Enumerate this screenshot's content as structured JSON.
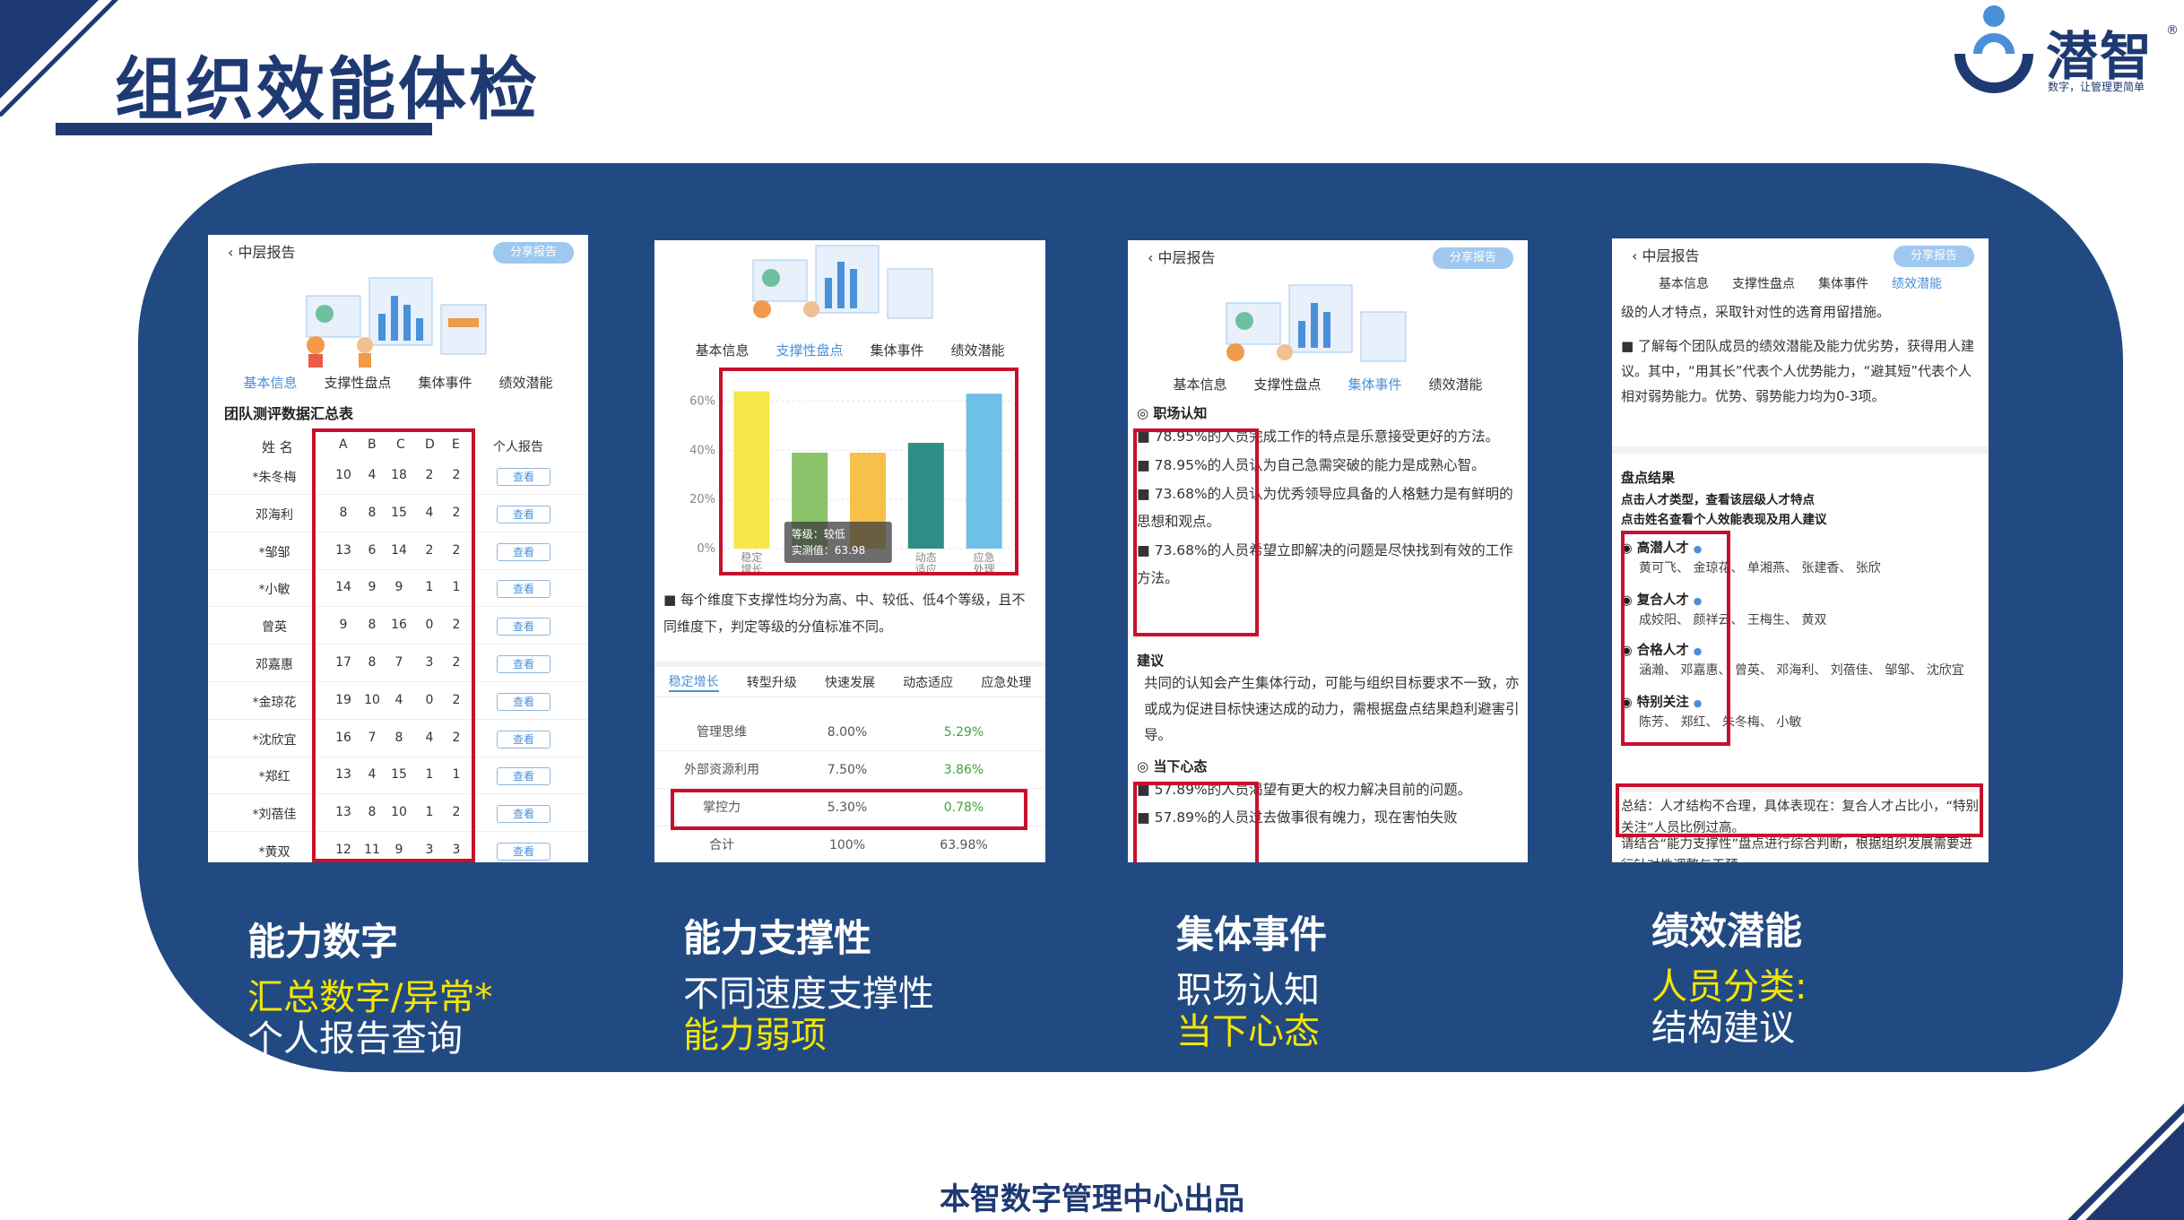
{
  "page": {
    "title": "组织效能体检",
    "footer": "本智数字管理中心出品"
  },
  "logo": {
    "text": "潜智",
    "slogan": "数字，让管理更简单",
    "reg": "®"
  },
  "colors": {
    "primary": "#1f3a72",
    "panel": "#224a82",
    "highlight": "#c8102e",
    "yellow": "#f4e500",
    "active_tab": "#4a90d9"
  },
  "card1": {
    "header_title": "中层报告",
    "share": "分享报告",
    "tabs": [
      "基本信息",
      "支撑性盘点",
      "集体事件",
      "绩效潜能"
    ],
    "section": "团队测评数据汇总表",
    "col_name": "姓  名",
    "cols": [
      "A",
      "B",
      "C",
      "D",
      "E"
    ],
    "col_report": "个人报告",
    "view": "查看",
    "rows": [
      {
        "name": "*朱冬梅",
        "vals": [
          "10",
          "4",
          "18",
          "2",
          "2"
        ]
      },
      {
        "name": "邓海利",
        "vals": [
          "8",
          "8",
          "15",
          "4",
          "2"
        ]
      },
      {
        "name": "*邹邹",
        "vals": [
          "13",
          "6",
          "14",
          "2",
          "2"
        ]
      },
      {
        "name": "*小敏",
        "vals": [
          "14",
          "9",
          "9",
          "1",
          "1"
        ]
      },
      {
        "name": "曾英",
        "vals": [
          "9",
          "8",
          "16",
          "0",
          "2"
        ]
      },
      {
        "name": "邓嘉惠",
        "vals": [
          "17",
          "8",
          "7",
          "3",
          "2"
        ]
      },
      {
        "name": "*金琼花",
        "vals": [
          "19",
          "10",
          "4",
          "0",
          "2"
        ]
      },
      {
        "name": "*沈欣宜",
        "vals": [
          "16",
          "7",
          "8",
          "4",
          "2"
        ]
      },
      {
        "name": "*郑红",
        "vals": [
          "13",
          "4",
          "15",
          "1",
          "1"
        ]
      },
      {
        "name": "*刘蓓佳",
        "vals": [
          "13",
          "8",
          "10",
          "1",
          "2"
        ]
      },
      {
        "name": "*黄双",
        "vals": [
          "12",
          "11",
          "9",
          "3",
          "3"
        ]
      }
    ]
  },
  "card2": {
    "tabs": [
      "基本信息",
      "支撑性盘点",
      "集体事件",
      "绩效潜能"
    ],
    "y_ticks": [
      "60%",
      "40%",
      "20%",
      "0%"
    ],
    "x_labels": [
      [
        "稳定",
        "增长"
      ],
      [
        "",
        ""
      ],
      [
        "",
        ""
      ],
      [
        "动态",
        "适应"
      ],
      [
        "应急",
        "处理"
      ]
    ],
    "tooltip_line1": "等级：较低",
    "tooltip_line2": "实测值：63.98",
    "desc": "每个维度下支撑性均分为高、中、较低、低4个等级，且不同维度下，判定等级的分值标准不同。",
    "sub_tabs": [
      "稳定增长",
      "转型升级",
      "快速发展",
      "动态适应",
      "应急处理"
    ],
    "table": [
      {
        "name": "管理思维",
        "a": "8.00%",
        "b": "5.29%"
      },
      {
        "name": "外部资源利用",
        "a": "7.50%",
        "b": "3.86%"
      },
      {
        "name": "掌控力",
        "a": "5.30%",
        "b": "0.78%"
      },
      {
        "name": "合计",
        "a": "100%",
        "b": "63.98%"
      }
    ]
  },
  "chart_data": {
    "type": "bar",
    "categories": [
      "稳定增长",
      "",
      "",
      "动态适应",
      "应急处理"
    ],
    "values": [
      63.98,
      39,
      39,
      43,
      63
    ],
    "colors": [
      "#f7e64a",
      "#8ac36a",
      "#f7c04a",
      "#2e8e86",
      "#6ec0e6"
    ],
    "ylim": [
      0,
      70
    ],
    "y_ticks": [
      0,
      20,
      40,
      60
    ],
    "grid": true
  },
  "card3": {
    "header_title": "中层报告",
    "share": "分享报告",
    "tabs": [
      "基本信息",
      "支撑性盘点",
      "集体事件",
      "绩效潜能"
    ],
    "sec1": "职场认知",
    "bullets1": [
      "78.95%的人员完成工作的特点是乐意接受更好的方法。",
      "78.95%的人员认为自己急需突破的能力是成熟心智。",
      "73.68%的人员认为优秀领导应具备的人格魅力是有鲜明的思想和观点。",
      "73.68%的人员希望立即解决的问题是尽快找到有效的工作方法。"
    ],
    "suggest_title": "建议",
    "suggest": "共同的认知会产生集体行动，可能与组织目标要求不一致，亦或成为促进目标快速达成的动力，需根据盘点结果趋利避害引导。",
    "sec2": "当下心态",
    "bullets2": [
      "57.89%的人员渴望有更大的权力解决目前的问题。",
      "57.89%的人员过去做事很有魄力，现在害怕失败"
    ]
  },
  "card4": {
    "header_title": "中层报告",
    "share": "分享报告",
    "tabs": [
      "基本信息",
      "支撑性盘点",
      "集体事件",
      "绩效潜能"
    ],
    "intro1": "级的人才特点，采取针对性的选育用留措施。",
    "intro2": "了解每个团队成员的绩效潜能及能力优劣势，获得用人建议。其中，“用其长”代表个人优势能力，“避其短”代表个人相对弱势能力。优势、弱势能力均为0-3项。",
    "result_title": "盘点结果",
    "hint1": "点击人才类型，查看该层级人才特点",
    "hint2": "点击姓名查看个人效能表现及用人建议",
    "groups": [
      {
        "label": "高潜人才",
        "names": "黄可飞、 金琼花、 单湘燕、 张建香、 张欣"
      },
      {
        "label": "复合人才",
        "names": "成姣阳、 颜祥云、 王梅生、 黄双"
      },
      {
        "label": "合格人才",
        "names": "涵瀚、 邓嘉惠、 曾英、 邓海利、 刘蓓佳、 邹邹、 沈欣宜"
      },
      {
        "label": "特别关注",
        "names": "陈芳、 郑红、 朱冬梅、 小敏"
      }
    ],
    "summary1": "总结：人才结构不合理，具体表现在：复合人才占比小，“特别关注”人员比例过高。",
    "summary2": "请结合“能力支撑性”盘点进行综合判断，根据组织发展需要进行针对性调整与干预。"
  },
  "captions": [
    {
      "h": "能力数字",
      "l1": "汇总数字/异常*",
      "l2": "个人报告查询"
    },
    {
      "h": "能力支撑性",
      "l1": "不同速度支撑性",
      "l2": "能力弱项"
    },
    {
      "h": "集体事件",
      "l1": "职场认知",
      "l2": "当下心态"
    },
    {
      "h": "绩效潜能",
      "l1": "人员分类:",
      "l2": "结构建议"
    }
  ]
}
